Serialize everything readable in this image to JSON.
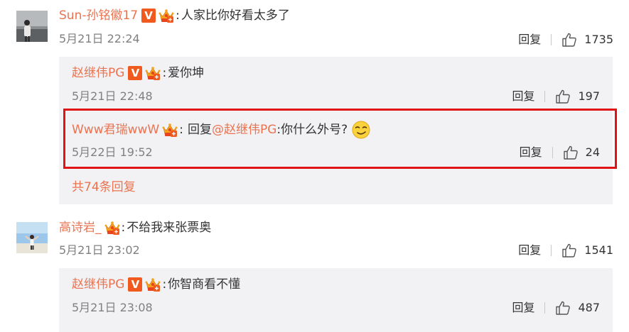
{
  "comments": [
    {
      "user": "Sun-孙铭徽17",
      "verified": "V",
      "text": "人家比你好看太多了",
      "date": "5月21日 22:24",
      "reply_label": "回复",
      "likes": "1735",
      "sub_replies": [
        {
          "user": "赵继伟PG",
          "verified": "V",
          "text": "爱你坤",
          "date": "5月21日 22:48",
          "reply_label": "回复",
          "likes": "197"
        },
        {
          "user": "Www君瑞wwW",
          "reply_prefix": "回复",
          "mention": "@赵继伟PG",
          "text": ":你什么外号?",
          "date": "5月22日 19:52",
          "reply_label": "回复",
          "likes": "24"
        }
      ],
      "more_replies": "共74条回复"
    },
    {
      "user": "高诗岩_",
      "text": "不给我来张票奥",
      "date": "5月21日 23:02",
      "reply_label": "回复",
      "likes": "1541",
      "sub_replies": [
        {
          "user": "赵继伟PG",
          "verified": "V",
          "text": "你智商看不懂",
          "date": "5月21日 23:08",
          "reply_label": "回复",
          "likes": "487"
        }
      ]
    }
  ],
  "colors": {
    "username": "#eb7350",
    "highlight_border": "#e01414",
    "sub_background": "#f2f2f5",
    "verified_badge": "#f05a1e"
  }
}
